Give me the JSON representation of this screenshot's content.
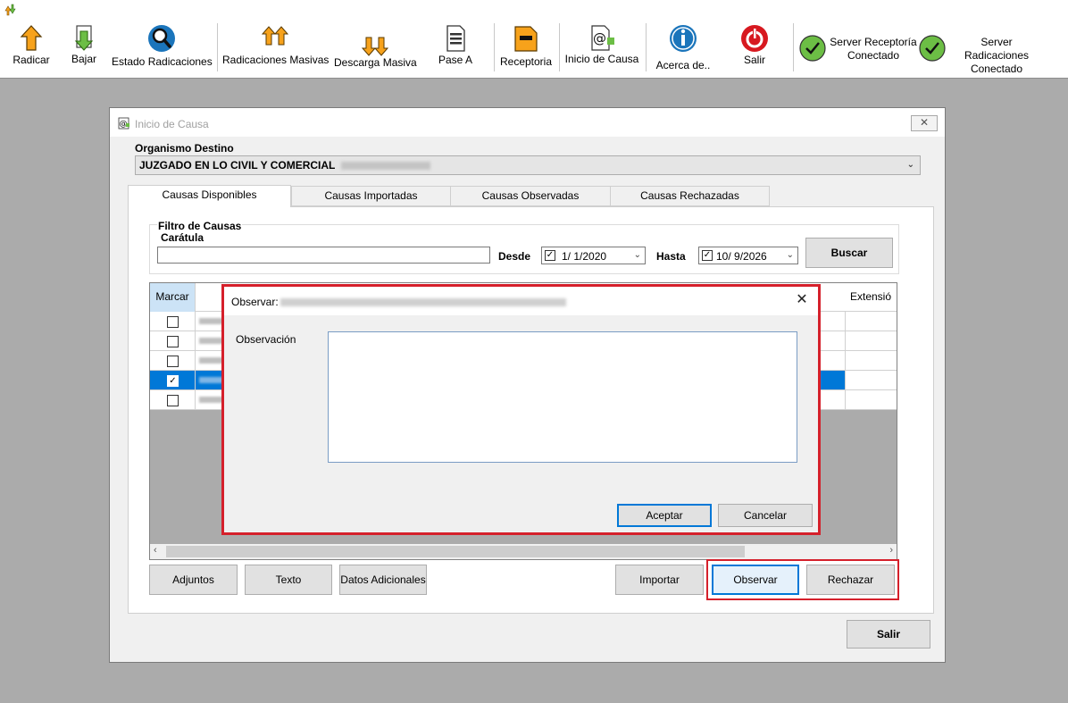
{
  "toolbar": {
    "buttons": [
      {
        "label": "Radicar",
        "icon": "upload-arrow-icon"
      },
      {
        "label": "Bajar",
        "icon": "download-arrow-icon"
      },
      {
        "label": "Estado Radicaciones",
        "icon": "search-icon"
      },
      {
        "label": "Radicaciones Masivas",
        "icon": "multi-upload-icon"
      },
      {
        "label": "Descarga Masiva",
        "icon": "multi-download-icon"
      },
      {
        "label": "Pase A",
        "icon": "document-icon"
      },
      {
        "label": "Receptoria",
        "icon": "folder-icon"
      },
      {
        "label": "Inicio de Causa",
        "icon": "at-document-icon"
      },
      {
        "label": "Acerca de..",
        "icon": "info-icon"
      },
      {
        "label": "Salir",
        "icon": "power-icon"
      }
    ],
    "servers": [
      {
        "line1": "Server Receptoría",
        "line2": "Conectado",
        "icon": "check-icon"
      },
      {
        "line1": "Server Radicaciones",
        "line2": "Conectado",
        "icon": "check-icon"
      }
    ]
  },
  "window": {
    "title": "Inicio de Causa",
    "close_label": "✕",
    "org_label": "Organismo Destino",
    "org_value": "JUZGADO EN LO CIVIL Y COMERCIAL",
    "tabs": [
      "Causas Disponibles",
      "Causas Importadas",
      "Causas Observadas",
      "Causas Rechazadas"
    ],
    "filter": {
      "legend": "Filtro de Causas",
      "caratula_label": "Carátula",
      "caratula_value": "",
      "desde_label": "Desde",
      "desde_value": "1/  1/2020",
      "hasta_label": "Hasta",
      "hasta_value": "10/  9/2026",
      "buscar_label": "Buscar"
    },
    "grid": {
      "col_marcar": "Marcar",
      "col_extension": "Extensió",
      "rows": [
        {
          "checked": false
        },
        {
          "checked": false
        },
        {
          "checked": false
        },
        {
          "checked": true,
          "selected": true
        },
        {
          "checked": false
        }
      ]
    },
    "buttons": {
      "adjuntos": "Adjuntos",
      "texto": "Texto",
      "datos_adicionales": "Datos Adicionales",
      "importar": "Importar",
      "observar": "Observar",
      "rechazar": "Rechazar",
      "salir": "Salir"
    }
  },
  "dialog": {
    "title": "Observar:",
    "close_label": "✕",
    "observacion_label": "Observación",
    "observacion_value": "",
    "aceptar_label": "Aceptar",
    "cancelar_label": "Cancelar"
  },
  "colors": {
    "highlight": "#d5202b",
    "selection": "#0078d7",
    "icon_orange": "#f7a21b",
    "icon_green": "#6cbe45",
    "icon_blue": "#1b75bb",
    "icon_red": "#d71920"
  }
}
